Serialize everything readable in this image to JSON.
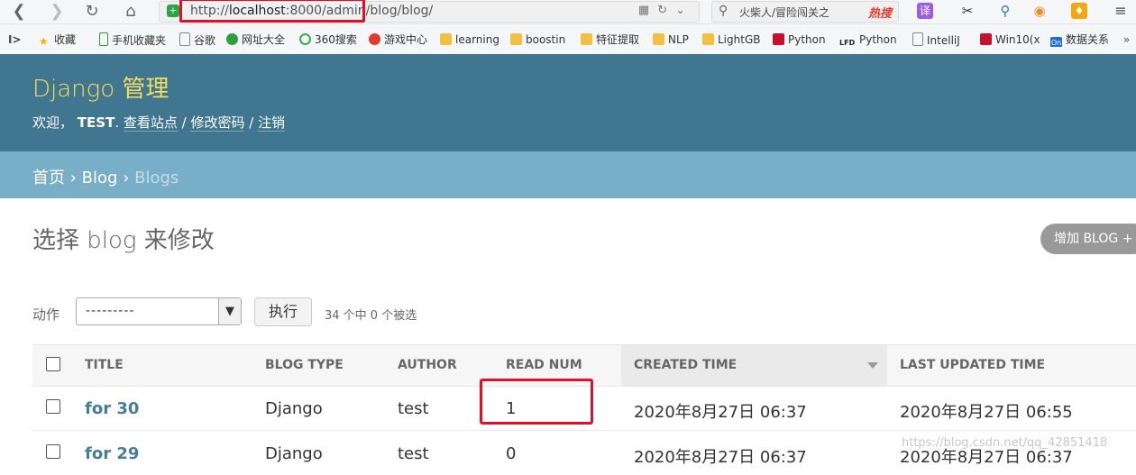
{
  "browser": {
    "url_prefix": "http://",
    "url_host": "localhost",
    "url_rest": ":8000/admin/blog/blog/",
    "search_query": "火柴人/冒险闯关之",
    "search_hot": "热搜",
    "translate_label": "译"
  },
  "bookmarks": [
    {
      "label": "收藏",
      "icon": "star-icon"
    },
    {
      "label": "手机收藏夹",
      "icon": "phone-icon"
    },
    {
      "label": "谷歌",
      "icon": "page-icon"
    },
    {
      "label": "网址大全",
      "icon": "globe-icon"
    },
    {
      "label": "360搜索",
      "icon": "search-360-icon"
    },
    {
      "label": "游戏中心",
      "icon": "game-icon"
    },
    {
      "label": "learning",
      "icon": "folder-icon"
    },
    {
      "label": "boostin",
      "icon": "folder-icon"
    },
    {
      "label": "特征提取",
      "icon": "folder-icon"
    },
    {
      "label": "NLP",
      "icon": "folder-icon"
    },
    {
      "label": "LightGB",
      "icon": "folder-icon"
    },
    {
      "label": "Python",
      "icon": "csdn-icon"
    },
    {
      "label": "Python",
      "icon": "lfd-icon"
    },
    {
      "label": "IntelliJ",
      "icon": "page-icon"
    },
    {
      "label": "Win10(x",
      "icon": "csdn-icon"
    },
    {
      "label": "数据关系",
      "icon": "on-icon"
    }
  ],
  "header": {
    "brand": "Django 管理",
    "welcome": "欢迎，",
    "username": "TEST",
    "view_site": "查看站点",
    "change_password": "修改密码",
    "logout": "注销"
  },
  "breadcrumbs": {
    "home": "首页",
    "app": "Blog",
    "current": "Blogs"
  },
  "content": {
    "title": "选择 blog 来修改",
    "add_button": "增加 BLOG",
    "action_label": "动作",
    "action_selected": "---------",
    "run_button": "执行",
    "selection_count": "34 个中 0 个被选"
  },
  "table": {
    "columns": [
      "TITLE",
      "BLOG TYPE",
      "AUTHOR",
      "READ NUM",
      "CREATED TIME",
      "LAST UPDATED TIME"
    ],
    "rows": [
      {
        "title": "for 30",
        "blog_type": "Django",
        "author": "test",
        "read_num": "1",
        "created": "2020年8月27日 06:37",
        "updated": "2020年8月27日 06:55"
      },
      {
        "title": "for 29",
        "blog_type": "Django",
        "author": "test",
        "read_num": "0",
        "created": "2020年8月27日 06:37",
        "updated": "2020年8月27日 06:37"
      }
    ]
  },
  "watermark": "https://blog.csdn.net/qq_42851418",
  "colors": {
    "header_bg": "#417690",
    "brand": "#f5dd5d",
    "breadcrumb_bg": "#79aec8",
    "link": "#447e9b",
    "highlight_red": "#e0102a"
  }
}
